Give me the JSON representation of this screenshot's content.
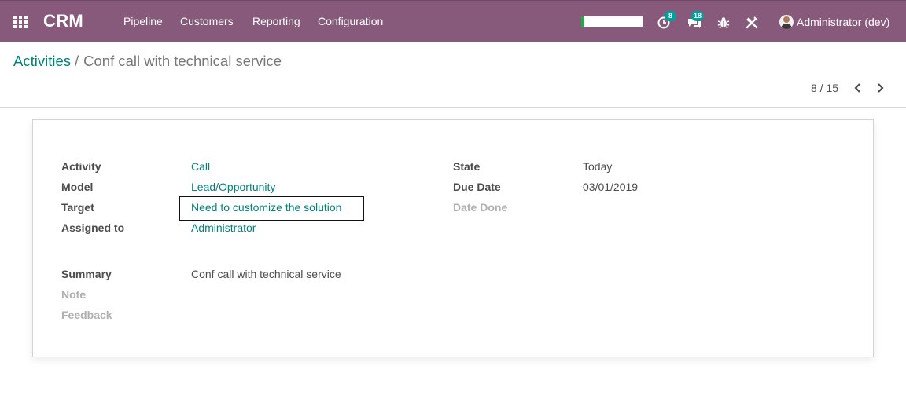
{
  "navbar": {
    "brand": "CRM",
    "menu": [
      "Pipeline",
      "Customers",
      "Reporting",
      "Configuration"
    ],
    "activity_count": "8",
    "message_count": "18",
    "user": "Administrator (dev)",
    "color": "#875a7b",
    "badge_color": "#00a09d"
  },
  "breadcrumb": {
    "parent": "Activities",
    "separator": "/",
    "current": "Conf call with technical service"
  },
  "pager": {
    "value": "8 / 15"
  },
  "form": {
    "left": [
      {
        "label": "Activity",
        "value": "Call"
      },
      {
        "label": "Model",
        "value": "Lead/Opportunity"
      },
      {
        "label": "Target",
        "value": "Need to customize the solution"
      },
      {
        "label": "Assigned to",
        "value": "Administrator"
      }
    ],
    "right": [
      {
        "label": "State",
        "value": "Today"
      },
      {
        "label": "Due Date",
        "value": "03/01/2019"
      },
      {
        "label": "Date Done",
        "value": ""
      }
    ],
    "bottom": [
      {
        "label": "Summary",
        "value": "Conf call with technical service"
      },
      {
        "label": "Note",
        "value": ""
      },
      {
        "label": "Feedback",
        "value": ""
      }
    ],
    "link_color": "#00827d"
  }
}
